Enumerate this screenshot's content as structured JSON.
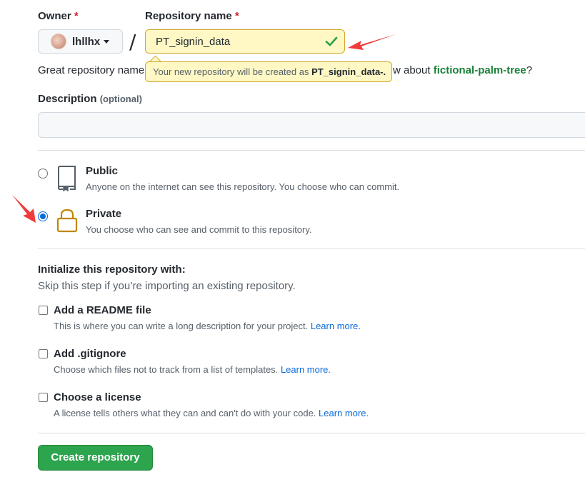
{
  "owner": {
    "label": "Owner",
    "required_mark": "*",
    "value": "lhllhx"
  },
  "repo_name": {
    "label": "Repository name",
    "required_mark": "*",
    "value": "PT_signin_data",
    "tooltip_prefix": "Your new repository will be created as",
    "tooltip_name": "PT_signin_data-."
  },
  "separator": "/",
  "suggestion": {
    "left_text": "Great repository name",
    "right_text": "w about",
    "name": "fictional-palm-tree",
    "end": "?"
  },
  "description": {
    "label": "Description",
    "optional": "(optional)",
    "value": ""
  },
  "visibility": {
    "options": [
      {
        "title": "Public",
        "desc": "Anyone on the internet can see this repository. You choose who can commit.",
        "checked": false,
        "icon": "repo-icon"
      },
      {
        "title": "Private",
        "desc": "You choose who can see and commit to this repository.",
        "checked": true,
        "icon": "lock-icon"
      }
    ]
  },
  "init": {
    "title": "Initialize this repository with:",
    "subtitle": "Skip this step if you’re importing an existing repository.",
    "options": [
      {
        "title": "Add a README file",
        "desc": "This is where you can write a long description for your project.",
        "link": "Learn more."
      },
      {
        "title": "Add .gitignore",
        "desc": "Choose which files not to track from a list of templates.",
        "link": "Learn more."
      },
      {
        "title": "Choose a license",
        "desc": "A license tells others what they can and can't do with your code.",
        "link": "Learn more."
      }
    ]
  },
  "create_button": "Create repository",
  "colors": {
    "primary": "#2da44e",
    "link": "#0969da",
    "success": "#1a7f37",
    "annotation": "#f03c3c",
    "lock": "#bf8700"
  }
}
